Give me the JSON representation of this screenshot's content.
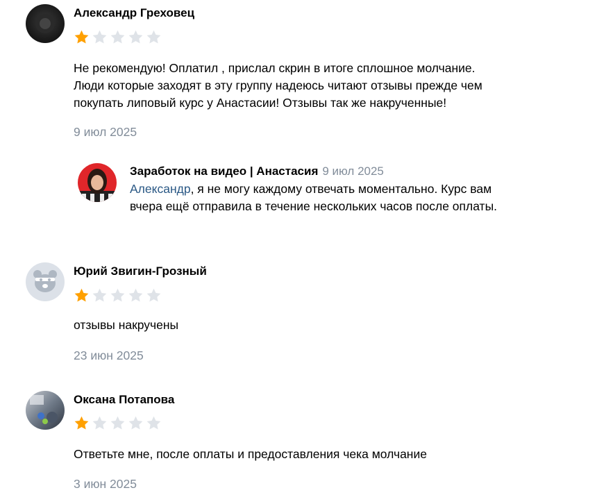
{
  "reviews": [
    {
      "author": "Александр Греховец",
      "rating": 1,
      "max_rating": 5,
      "text_lines": [
        "Не рекомендую! Оплатил , прислал скрин в итоге сплошное молчание.",
        "Люди которые заходят в эту группу надеюсь читают отзывы прежде чем",
        "покупать липовый курс у Анастасии! Отзывы так же накрученные!"
      ],
      "date": "9 июл 2025",
      "reply": {
        "author": "Заработок на видео | Анастасия",
        "date": "9 июл 2025",
        "mention": "Александр",
        "line1_rest": ", я не могу каждому отвечать моментально. Курс вам",
        "line2": "вчера ещё отправила в течение нескольких часов после оплаты."
      }
    },
    {
      "author": "Юрий Звигин-Грозный",
      "rating": 1,
      "max_rating": 5,
      "text": "отзывы накручены",
      "date": "23 июн 2025"
    },
    {
      "author": "Оксана Потапова",
      "rating": 1,
      "max_rating": 5,
      "text": "Ответьте мне, после оплаты и предоставления чека молчание",
      "date": "3 июн 2025"
    }
  ],
  "colors": {
    "star_filled": "#ffa000",
    "star_empty": "#dfe3e8",
    "date": "#818c99",
    "mention": "#2a5885"
  }
}
